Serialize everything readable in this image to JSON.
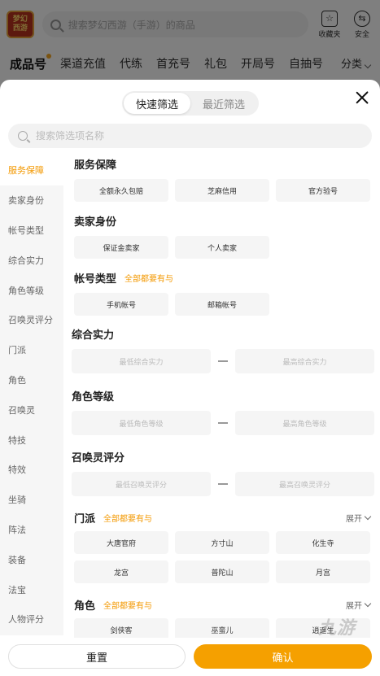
{
  "app": {
    "logo_lines": [
      "梦幻",
      "西游"
    ],
    "search_placeholder": "搜索梦幻西游（手游）的商品",
    "icons": [
      {
        "name": "favorites-icon",
        "label": "收藏夹",
        "glyph": "☆"
      },
      {
        "name": "safety-icon",
        "label": "安全",
        "glyph": "⇆"
      }
    ],
    "tabs": [
      "成品号",
      "渠道充值",
      "代练",
      "首充号",
      "礼包",
      "开局号",
      "自抽号"
    ],
    "tabs_more": "分类",
    "active_tab": 0
  },
  "filter": {
    "segment": [
      "快速筛选",
      "最近筛选"
    ],
    "active_segment": 0,
    "search_placeholder": "搜索筛选项名称",
    "sidebar": [
      "服务保障",
      "卖家身份",
      "帐号类型",
      "综合实力",
      "角色等级",
      "召唤灵评分",
      "门派",
      "角色",
      "召唤灵",
      "特技",
      "特效",
      "坐骑",
      "阵法",
      "装备",
      "法宝",
      "人物评分"
    ],
    "active_sidebar": 0,
    "sections": {
      "service": {
        "title": "服务保障",
        "options": [
          "全额永久包赔",
          "芝麻信用",
          "官方验号"
        ]
      },
      "seller": {
        "title": "卖家身份",
        "options": [
          "保证金卖家",
          "个人卖家"
        ]
      },
      "account_type": {
        "title": "帐号类型",
        "note": "全部都要有与",
        "options": [
          "手机帐号",
          "邮箱帐号"
        ]
      },
      "power": {
        "title": "综合实力",
        "min_placeholder": "最低综合实力",
        "max_placeholder": "最高综合实力"
      },
      "level": {
        "title": "角色等级",
        "min_placeholder": "最低角色等级",
        "max_placeholder": "最高角色等级"
      },
      "pet_score": {
        "title": "召唤灵评分",
        "min_placeholder": "最低召唤灵评分",
        "max_placeholder": "最高召唤灵评分"
      },
      "school": {
        "title": "门派",
        "note": "全部都要有与",
        "expand": "展开",
        "options": [
          "大唐官府",
          "方寸山",
          "化生寺",
          "龙宫",
          "普陀山",
          "月宫"
        ]
      },
      "role": {
        "title": "角色",
        "note": "全部都要有与",
        "expand": "展开",
        "options": [
          "剑侠客",
          "巫蛮儿",
          "逍遥生"
        ]
      }
    },
    "reset_label": "重置",
    "confirm_label": "确认"
  },
  "watermark": "九游",
  "colors": {
    "accent": "#f5a000",
    "accent_text": "#f39800"
  }
}
